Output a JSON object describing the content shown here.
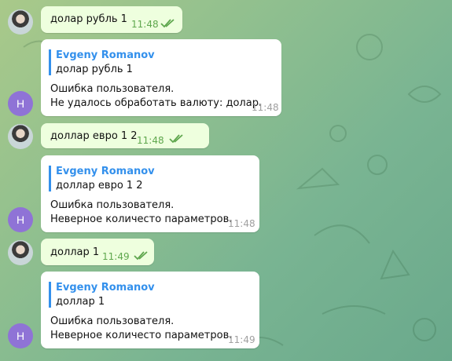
{
  "messages": [
    {
      "type": "out",
      "text": "долар рубль 1",
      "time": "11:48"
    },
    {
      "type": "in",
      "avatar_letter": "H",
      "quote_name": "Evgeny Romanov",
      "quote_text": "долар рубль 1",
      "line1": "Ошибка пользователя.",
      "line2": "Не удалось обработать валюту: долар.",
      "time": "11:48"
    },
    {
      "type": "out",
      "text": "доллар евро 1 2",
      "time": "11:48"
    },
    {
      "type": "in",
      "avatar_letter": "H",
      "quote_name": "Evgeny Romanov",
      "quote_text": "доллар евро 1 2",
      "line1": "Ошибка пользователя.",
      "line2": "Неверное количесто параметров.",
      "time": "11:48"
    },
    {
      "type": "out",
      "text": "доллар 1",
      "time": "11:49"
    },
    {
      "type": "in",
      "avatar_letter": "H",
      "quote_name": "Evgeny Romanov",
      "quote_text": "доллар 1",
      "line1": "Ошибка пользователя.",
      "line2": "Неверное количесто параметров.",
      "time": "11:49"
    }
  ],
  "colors": {
    "accent": "#3390ec",
    "outgoing_bg": "#eeffde",
    "incoming_bg": "#ffffff",
    "avatar_bg": "#8f73d6",
    "check_color": "#5fa74e"
  },
  "icons": {
    "read_receipt": "double-check-icon",
    "user_avatar": "user-photo-avatar",
    "bot_avatar": "letter-avatar"
  }
}
